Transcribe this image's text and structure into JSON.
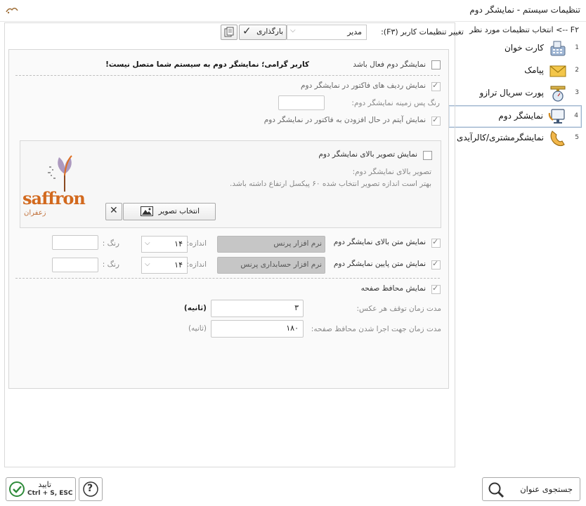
{
  "window": {
    "title": "تنظیمات سیستم - نمایشگر دوم",
    "close_glyph": "✕"
  },
  "nav": {
    "header": "F۲ --> انتخاب تنظیمات مورد نظر",
    "items": [
      {
        "num": "1",
        "label": "کارت خوان"
      },
      {
        "num": "2",
        "label": "پیامک"
      },
      {
        "num": "3",
        "label": "پورت سریال ترازو"
      },
      {
        "num": "4",
        "label": "نمایشگر دوم"
      },
      {
        "num": "5",
        "label": "نمایشگرمشتری/کالرآیدی"
      }
    ]
  },
  "toolbar": {
    "user_settings_label": "تغییر تنظیمات کاربر (F۳):",
    "user_select_value": "مدیر",
    "reload_label": "بارگذاری"
  },
  "form": {
    "enable_label": "نمایشگر دوم فعال باشد",
    "warning": "کاربر گرامی؛ نمایشگر دوم به سیستم شما متصل نیست!",
    "show_invoice_rows": "نمایش ردیف های فاکتور در نمایشگر دوم",
    "bg_color_label": "رنگ پس زمینه نمایشگر دوم:",
    "show_adding_item": "نمایش آیتم در حال افزودن به فاکتور در نمایشگر دوم",
    "show_top_image": "نمایش تصویر بالای نمایشگر دوم",
    "top_image_label": "تصویر بالای نمایشگر دوم:",
    "top_image_hint": "بهتر است اندازه تصویر انتخاب شده ۶۰ پیکسل ارتفاع داشته باشد.",
    "choose_image": "انتخاب تصویر",
    "logo_text": "saffron",
    "logo_text_fa": "زعفران",
    "top_text_label": "نمایش متن بالای نمایشگر دوم",
    "top_text_value": "نرم افزار پرنس",
    "bottom_text_label": "نمایش متن پایین نمایشگر دوم",
    "bottom_text_value": "نرم افزار حسابداری پرنس",
    "size_label": "اندازه:",
    "size_value": "۱۴",
    "color_label": "رنگ :",
    "screensaver_label": "نمایش محافظ صفحه",
    "pause_label": "مدت زمان توقف هر عکس:",
    "pause_value": "۳",
    "seconds": "(ثانیه)",
    "run_label": "مدت زمان جهت اجرا شدن محافظ صفحه:",
    "run_value": "۱۸۰"
  },
  "footer": {
    "confirm_label": "تایید",
    "confirm_shortcut": "Ctrl + S, ESC",
    "help_glyph": "?",
    "search_label": "جستجوی عنوان"
  },
  "colors": {
    "confirm_green": "#2e8b3a",
    "warning_text": "#111111",
    "nav_active_border": "#9db3cc"
  }
}
